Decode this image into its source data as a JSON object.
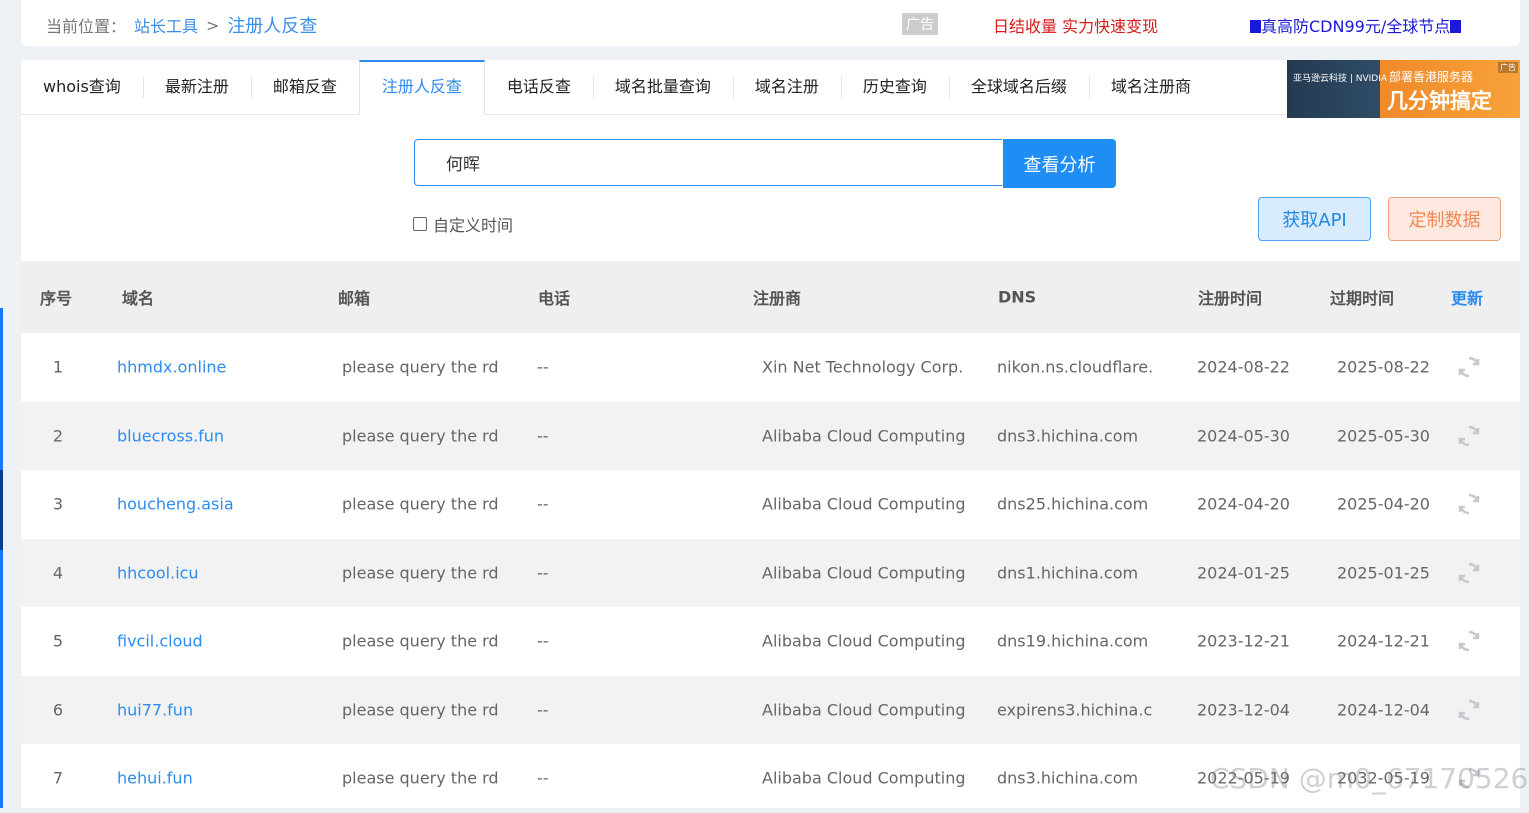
{
  "breadcrumb": {
    "prefix": "当前位置：",
    "parent": "站长工具",
    "separator": ">",
    "current": "注册人反查"
  },
  "ads": {
    "tag": "广告",
    "red_text": "日结收量 实力快速变现",
    "blue_text": "真高防CDN99元/全球节点"
  },
  "banner": {
    "left_text": "亚马逊云科技 | NVIDIA",
    "small_text": "部署香港服务器",
    "big_text": "几分钟搞定",
    "tag": "广告"
  },
  "tabs": [
    {
      "label": "whois查询"
    },
    {
      "label": "最新注册"
    },
    {
      "label": "邮箱反查"
    },
    {
      "label": "注册人反查",
      "active": true
    },
    {
      "label": "电话反查"
    },
    {
      "label": "域名批量查询"
    },
    {
      "label": "域名注册"
    },
    {
      "label": "历史查询"
    },
    {
      "label": "全球域名后缀"
    },
    {
      "label": "域名注册商"
    }
  ],
  "search": {
    "value": "何晖",
    "button": "查看分析",
    "custom_time_label": "自定义时间"
  },
  "actions": {
    "api": "获取API",
    "custom_data": "定制数据"
  },
  "table": {
    "headers": {
      "no": "序号",
      "domain": "域名",
      "email": "邮箱",
      "phone": "电话",
      "registrar": "注册商",
      "dns": "DNS",
      "reg_time": "注册时间",
      "exp_time": "过期时间",
      "update": "更新"
    },
    "rows": [
      {
        "no": "1",
        "domain": "hhmdx.online",
        "email": "please query the rd",
        "phone": "--",
        "registrar": "Xin Net Technology Corp.",
        "dns": "nikon.ns.cloudflare.",
        "reg_time": "2024-08-22",
        "exp_time": "2025-08-22"
      },
      {
        "no": "2",
        "domain": "bluecross.fun",
        "email": "please query the rd",
        "phone": "--",
        "registrar": "Alibaba Cloud Computing",
        "dns": "dns3.hichina.com",
        "reg_time": "2024-05-30",
        "exp_time": "2025-05-30"
      },
      {
        "no": "3",
        "domain": "houcheng.asia",
        "email": "please query the rd",
        "phone": "--",
        "registrar": "Alibaba Cloud Computing",
        "dns": "dns25.hichina.com",
        "reg_time": "2024-04-20",
        "exp_time": "2025-04-20"
      },
      {
        "no": "4",
        "domain": "hhcool.icu",
        "email": "please query the rd",
        "phone": "--",
        "registrar": "Alibaba Cloud Computing",
        "dns": "dns1.hichina.com",
        "reg_time": "2024-01-25",
        "exp_time": "2025-01-25"
      },
      {
        "no": "5",
        "domain": "fivcil.cloud",
        "email": "please query the rd",
        "phone": "--",
        "registrar": "Alibaba Cloud Computing",
        "dns": "dns19.hichina.com",
        "reg_time": "2023-12-21",
        "exp_time": "2024-12-21"
      },
      {
        "no": "6",
        "domain": "hui77.fun",
        "email": "please query the rd",
        "phone": "--",
        "registrar": "Alibaba Cloud Computing",
        "dns": "expirens3.hichina.c",
        "reg_time": "2023-12-04",
        "exp_time": "2024-12-04"
      },
      {
        "no": "7",
        "domain": "hehui.fun",
        "email": "please query the rd",
        "phone": "--",
        "registrar": "Alibaba Cloud Computing",
        "dns": "dns3.hichina.com",
        "reg_time": "2022-05-19",
        "exp_time": "2032-05-19"
      }
    ]
  },
  "watermark": "CSDN @m0_67170526",
  "colors": {
    "accent": "#2d8cf0",
    "ad_red": "#d61a1a",
    "ad_blue": "#1a1ad6",
    "custom_btn": "#f08a55"
  }
}
